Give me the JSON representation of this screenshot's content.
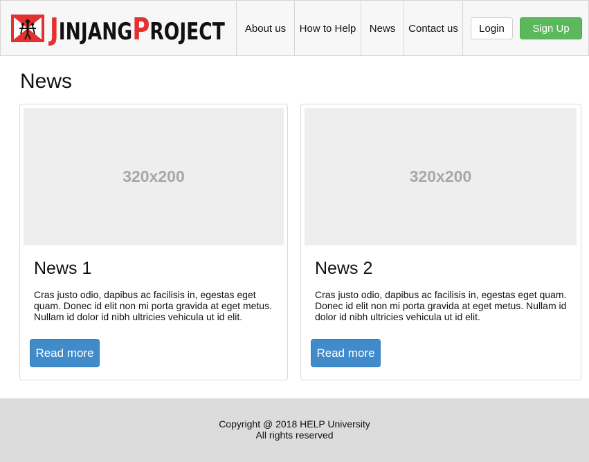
{
  "header": {
    "brand": {
      "big1": "J",
      "rest1": "INJANG",
      "big2": "P",
      "rest2": "ROJECT"
    },
    "nav": [
      "About us",
      "How to Help",
      "News",
      "Contact us"
    ],
    "login_label": "Login",
    "signup_label": "Sign Up"
  },
  "colors": {
    "brand_red": "#e53030",
    "signup_green": "#5cb85c",
    "read_more_blue": "#428bca",
    "footer_bg": "#dcdcdc"
  },
  "main": {
    "title": "News",
    "cards": [
      {
        "image_label": "320x200",
        "title": "News 1",
        "text": "Cras justo odio, dapibus ac facilisis in, egestas eget quam. Donec id elit non mi porta gravida at eget metus. Nullam id dolor id nibh ultricies vehicula ut id elit.",
        "button": "Read more"
      },
      {
        "image_label": "320x200",
        "title": "News 2",
        "text": "Cras justo odio, dapibus ac facilisis in, egestas eget quam. Donec id elit non mi porta gravida at eget metus. Nullam id dolor id nibh ultricies vehicula ut id elit.",
        "button": "Read more"
      }
    ]
  },
  "footer": {
    "line1": "Copyright @ 2018 HELP University",
    "line2": "All rights reserved"
  }
}
